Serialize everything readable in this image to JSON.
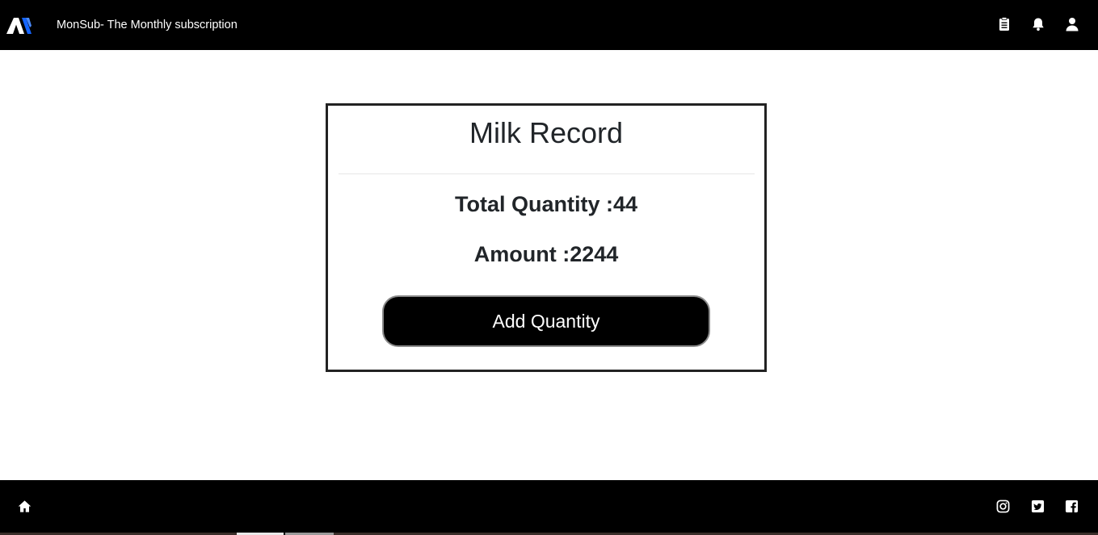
{
  "header": {
    "brand": "MonSub- The Monthly subscription",
    "logo_icon": "monsub-logo",
    "icons": [
      "clipboard-icon",
      "bell-icon",
      "user-icon"
    ]
  },
  "card": {
    "title": "Milk Record",
    "total_quantity_label": "Total Quantity :",
    "total_quantity_value": "44",
    "amount_label": "Amount :",
    "amount_value": "2244",
    "add_button_label": "Add Quantity"
  },
  "footer": {
    "icons": [
      "home-icon",
      "instagram-icon",
      "twitter-icon",
      "facebook-icon"
    ]
  },
  "colors": {
    "bar_background": "#000000",
    "page_background": "#ffffff",
    "text": "#212529",
    "logo_accent": "#1565ff"
  }
}
